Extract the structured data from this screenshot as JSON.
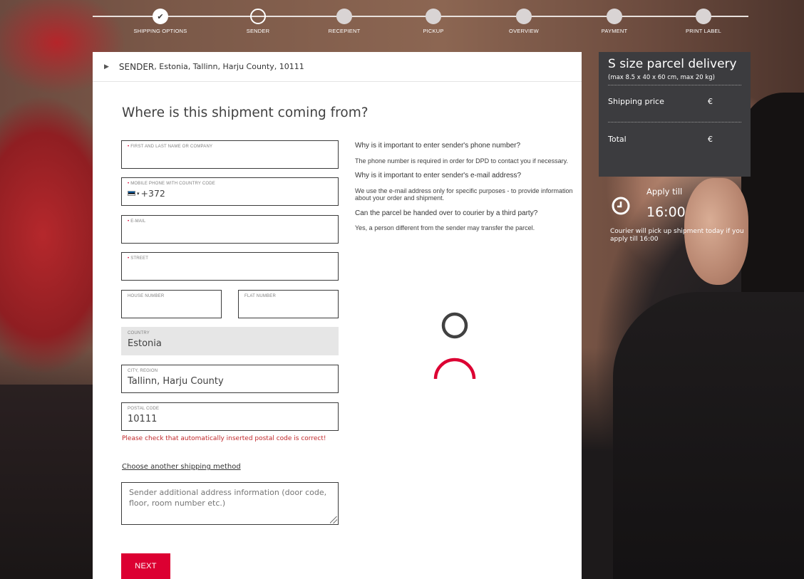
{
  "stepper": {
    "steps": [
      {
        "label": "SHIPPING OPTIONS",
        "state": "done"
      },
      {
        "label": "SENDER",
        "state": "current"
      },
      {
        "label": "RECEPIENT",
        "state": "todo"
      },
      {
        "label": "PICKUP",
        "state": "todo"
      },
      {
        "label": "OVERVIEW",
        "state": "todo"
      },
      {
        "label": "PAYMENT",
        "state": "todo"
      },
      {
        "label": "PRINT LABEL",
        "state": "todo"
      }
    ],
    "check_glyph": "✔"
  },
  "breadcrumb": {
    "prefix": "SENDER",
    "details": " , Estonia, Tallinn, Harju County, 10111"
  },
  "form": {
    "heading": "Where is this shipment coming from?",
    "required_mark": "•",
    "name_label": "FIRST AND LAST NAME OR COMPANY",
    "name_value": "",
    "phone_label": "MOBILE PHONE WITH COUNTRY CODE",
    "phone_prefix": "+372",
    "email_label": "E-MAIL",
    "email_value": "",
    "street_label": "STREET",
    "street_value": "",
    "house_label": "HOUSE NUMBER",
    "flat_label": "FLAT NUMBER",
    "country_label": "COUNTRY",
    "country_value": "Estonia",
    "city_label": "CITY, REGION",
    "city_value": "Tallinn, Harju County",
    "postal_label": "POSTAL CODE",
    "postal_value": "10111",
    "postal_warning": "Please check that automatically inserted postal code is correct!",
    "choose_link": "Choose another shipping method",
    "additional_placeholder": "Sender additional address information (door code, floor, room number etc.)",
    "next_label": "NEXT"
  },
  "info": {
    "q1": "Why is it important to enter sender's phone number?",
    "a1": "The phone number is required in order for DPD to contact you if necessary.",
    "q2": "Why is it important to enter sender's e-mail address?",
    "a2": "We use the e-mail address only for specific purposes - to provide information about your order and shipment.",
    "q3": "Can the parcel be handed over to courier by a third party?",
    "a3": "Yes, a person different from the sender may transfer the parcel."
  },
  "summary": {
    "title": "S size parcel delivery",
    "subtitle": "(max 8.5 x 40 x 60 cm, max 20 kg)",
    "shipping_label": "Shipping price",
    "shipping_value": "€",
    "total_label": "Total",
    "total_value": "€"
  },
  "apply": {
    "label": "Apply till",
    "time": "16:00",
    "note": "Courier will pick up shipment today if you apply till 16:00"
  },
  "colors": {
    "accent": "#dc0032",
    "summary_bg": "#3c3c3f"
  }
}
